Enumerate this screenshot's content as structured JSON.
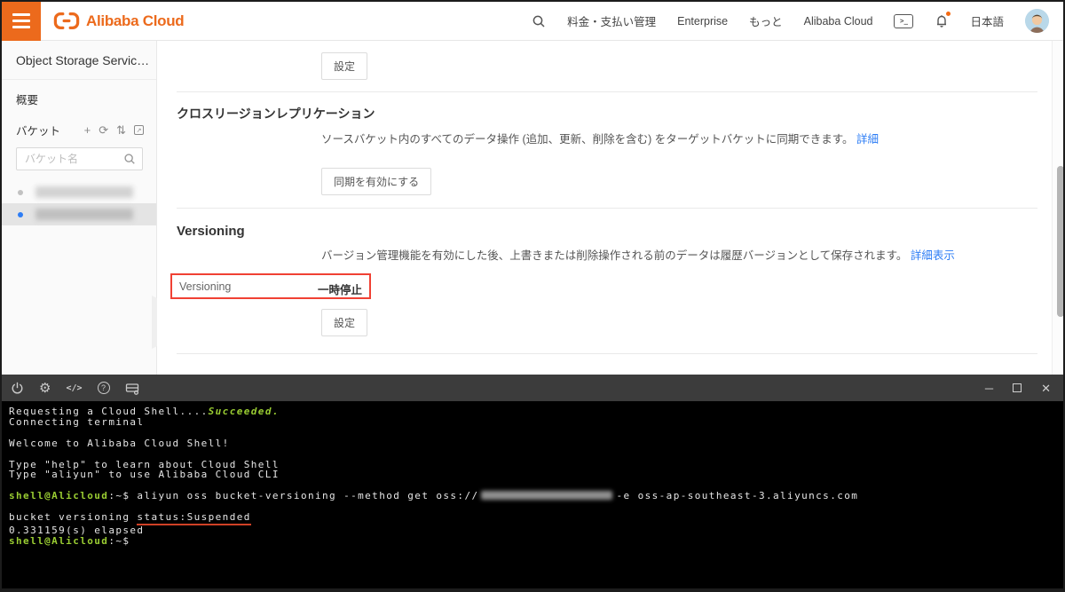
{
  "topbar": {
    "logo_text": "Alibaba Cloud",
    "nav": [
      "料金・支払い管理",
      "Enterprise",
      "もっと",
      "Alibaba Cloud"
    ],
    "language": "日本語"
  },
  "sidebar": {
    "title": "Object Storage Servic…",
    "overview": "概要",
    "bucket_label": "バケット",
    "search_placeholder": "バケット名"
  },
  "main": {
    "top_section": {
      "settings_button": "設定"
    },
    "crr": {
      "title": "クロスリージョンレプリケーション",
      "description": "ソースバケット内のすべてのデータ操作 (追加、更新、削除を含む) をターゲットバケットに同期できます。",
      "detail_link": "詳細",
      "enable_button": "同期を有効にする"
    },
    "versioning": {
      "title": "Versioning",
      "description": "バージョン管理機能を有効にした後、上書きまたは削除操作される前のデータは履歴バージョンとして保存されます。",
      "detail_link": "詳細表示",
      "row_label": "Versioning",
      "row_value": "一時停止",
      "settings_button": "設定"
    }
  },
  "terminal": {
    "requesting": "Requesting a Cloud Shell....",
    "succeeded": "Succeeded.",
    "connecting": "Connecting terminal",
    "welcome": "Welcome to Alibaba Cloud Shell!",
    "help_hint": "Type \"help\" to learn about Cloud Shell",
    "cli_hint": "Type \"aliyun\" to use Alibaba Cloud CLI",
    "prompt_user": "shell@Alicloud",
    "prompt_suffix": ":~$ ",
    "command": "aliyun oss bucket-versioning --method get oss://",
    "command_tail": "-e oss-ap-southeast-3.aliyuncs.com",
    "result_prefix": "bucket versioning ",
    "result_status": "status:Suspended",
    "elapsed": "0.331159(s) elapsed"
  },
  "colors": {
    "brand_orange": "#ec6a1c",
    "link_blue": "#2d7df5",
    "highlight_red": "#f04134",
    "terminal_green": "#9acd32",
    "selected_dot_blue": "#2d7df5",
    "terminal_header_bg": "#3c3c3c"
  }
}
